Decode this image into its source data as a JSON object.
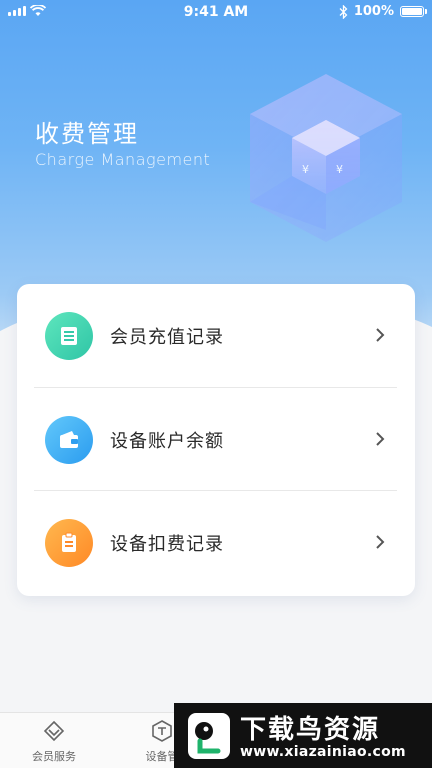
{
  "status_bar": {
    "time": "9:41 AM",
    "battery": "100%"
  },
  "header": {
    "title": "收费管理",
    "subtitle": "Charge Management"
  },
  "menu": [
    {
      "label": "会员充值记录",
      "icon": "receipt-icon",
      "color_from": "#4fe0b5",
      "color_to": "#2fc8a8"
    },
    {
      "label": "设备账户余额",
      "icon": "wallet-icon",
      "color_from": "#57c0f8",
      "color_to": "#2f9ff0"
    },
    {
      "label": "设备扣费记录",
      "icon": "clipboard-icon",
      "color_from": "#ffb14a",
      "color_to": "#ff8a2a"
    }
  ],
  "tabbar": [
    {
      "label": "会员服务",
      "icon": "diamond-icon"
    },
    {
      "label": "设备管",
      "icon": "device-icon"
    }
  ],
  "watermark": {
    "title": "下载鸟资源",
    "url": "www.xiazainiao.com"
  }
}
